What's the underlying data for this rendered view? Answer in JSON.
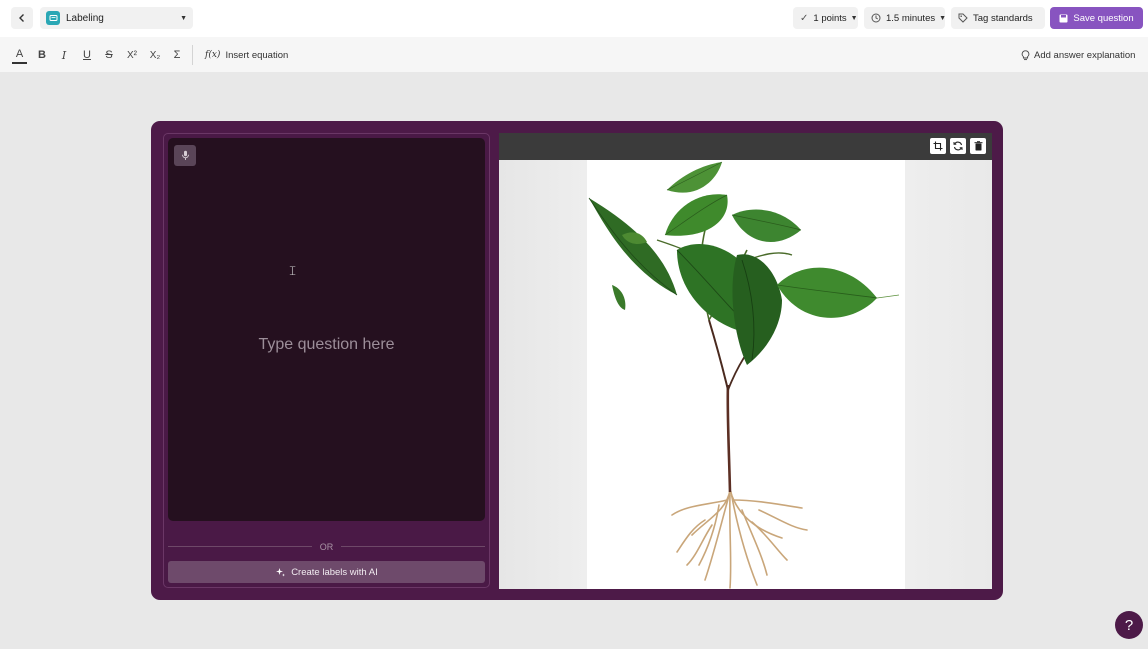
{
  "header": {
    "question_type": "Labeling",
    "points_label": "1 points",
    "time_label": "1.5 minutes",
    "tag_label": "Tag standards",
    "save_label": "Save question"
  },
  "toolbar": {
    "format_buttons": [
      "A",
      "B",
      "I",
      "U",
      "S",
      "X²",
      "X₂",
      "Σ"
    ],
    "equation_label": "Insert equation",
    "explanation_label": "Add answer explanation"
  },
  "editor": {
    "placeholder": "Type question here",
    "or_label": "OR",
    "ai_button_label": "Create labels with AI"
  },
  "help": {
    "label": "?"
  },
  "colors": {
    "accent": "#8854c0",
    "card": "#4d1a48",
    "editor_bg": "#25101f"
  }
}
